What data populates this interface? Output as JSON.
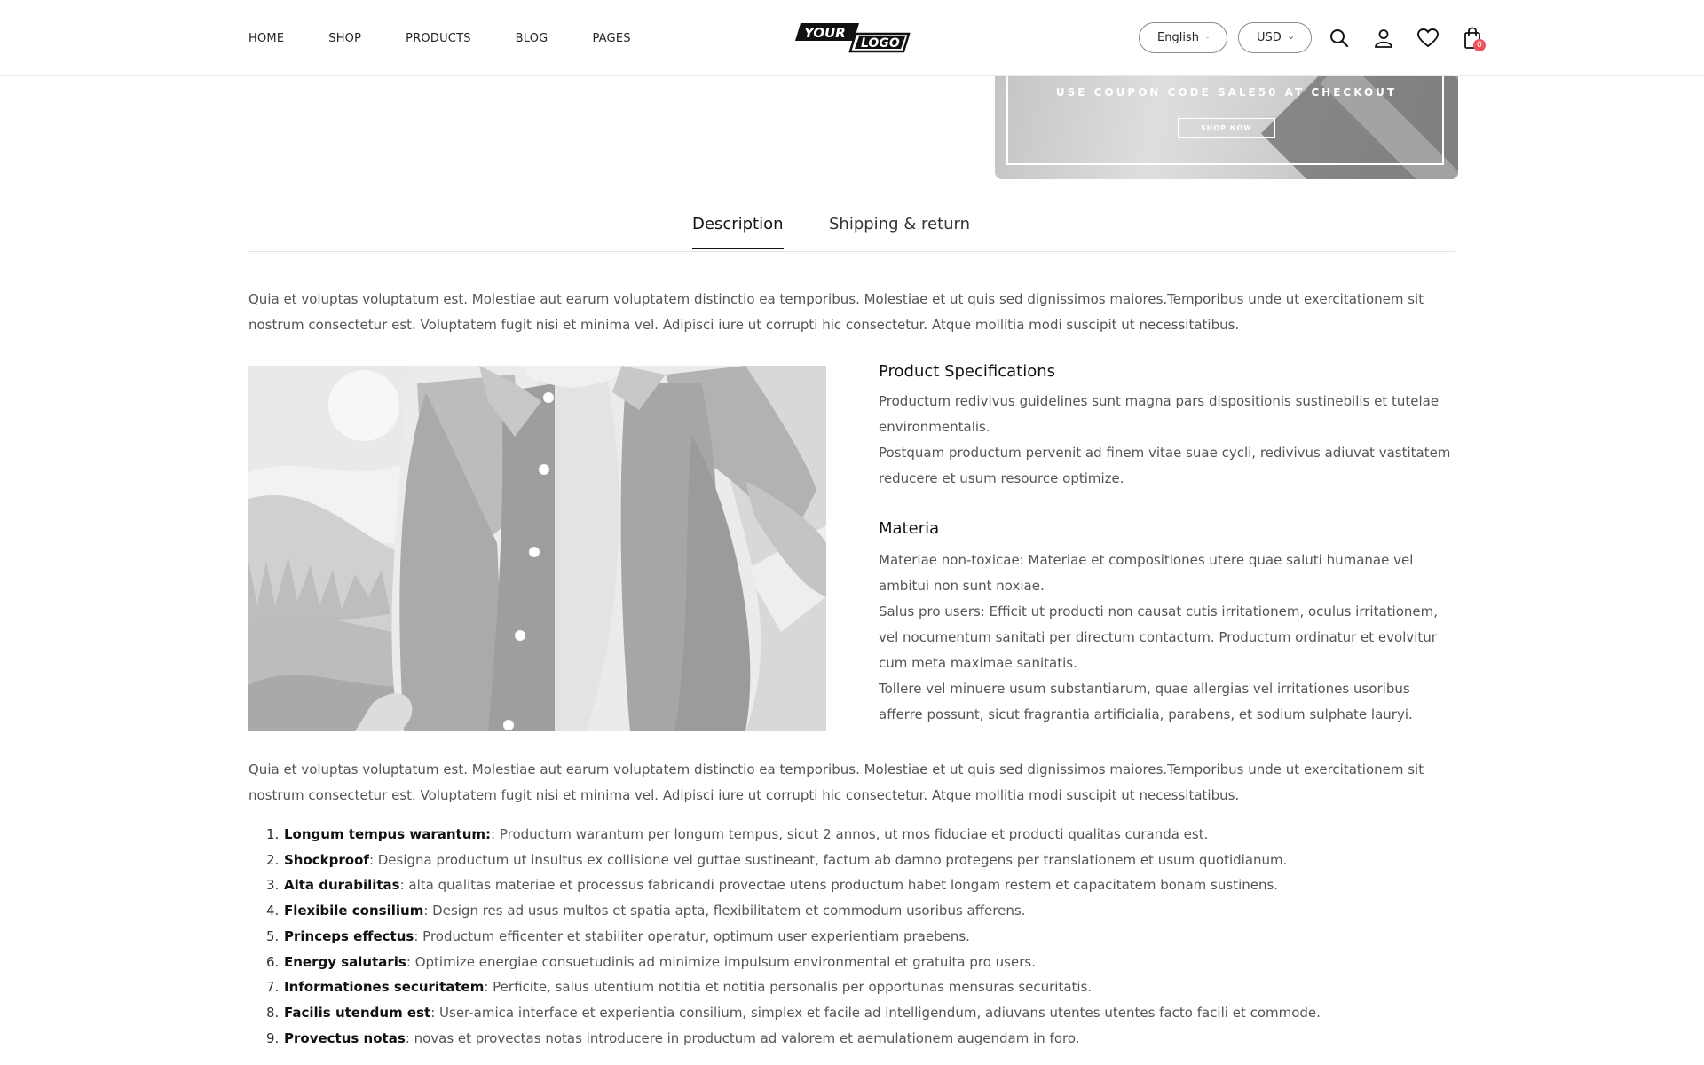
{
  "header": {
    "nav": [
      "HOME",
      "SHOP",
      "PRODUCTS",
      "BLOG",
      "PAGES"
    ],
    "logo": {
      "top": "YOUR",
      "bottom": "LOGO"
    },
    "language": "English",
    "currency": "USD",
    "cart_count": "0",
    "icons": [
      "search-icon",
      "user-icon",
      "heart-icon",
      "cart-icon"
    ]
  },
  "banner": {
    "coupon_text": "USE COUPON CODE SALE50 AT CHECKOUT",
    "button_label": "SHOP NOW"
  },
  "tabs": [
    {
      "label": "Description",
      "active": true
    },
    {
      "label": "Shipping & return",
      "active": false
    }
  ],
  "description": {
    "intro": "Quia et voluptas voluptatum est. Molestiae aut earum voluptatem distinctio ea temporibus. Molestiae et ut quis sed dignissimos maiores.Temporibus unde ut exercitationem sit nostrum consectetur est. Voluptatem fugit nisi et minima vel. Adipisci iure ut corrupti hic consectetur. Atque mollitia modi suscipit ut necessitatibus.",
    "outro": "Quia et voluptas voluptatum est. Molestiae aut earum voluptatem distinctio ea temporibus. Molestiae et ut quis sed dignissimos maiores.Temporibus unde ut exercitationem sit nostrum consectetur est. Voluptatem fugit nisi et minima vel. Adipisci iure ut corrupti hic consectetur. Atque mollitia modi suscipit ut necessitatibus.",
    "specs": {
      "title": "Product Specifications",
      "lines": [
        "Productum redivivus guidelines sunt magna pars dispositionis sustinebilis et tutelae environmentalis.",
        "Postquam productum pervenit ad finem vitae suae cycli, redivivus adiuvat vastitatem reducere et usum resource optimize."
      ]
    },
    "materia": {
      "title": "Materia",
      "lines": [
        "Materiae non-toxicae: Materiae et compositiones utere quae saluti humanae vel ambitui non sunt noxiae.",
        "Salus pro users: Efficit ut producti non causat cutis irritationem, oculus irritationem, vel nocumentum sanitati per directum contactum. Productum ordinatur et evolvitur cum meta maximae sanitatis.",
        "Tollere vel minuere usum substantiarum, quae allergias vel irritationes usoribus afferre possunt, sicut fragrantia artificialia, parabens, et sodium sulphate lauryi."
      ]
    },
    "features": [
      {
        "num": "1.",
        "term": "Longum tempus warantum:",
        "text": ": Productum warantum per longum tempus, sicut 2 annos, ut mos fiduciae et producti qualitas curanda est."
      },
      {
        "num": "2.",
        "term": "Shockproof",
        "text": ": Designa productum ut insultus ex collisione vel guttae sustineant, factum ab damno protegens per translationem et usum quotidianum."
      },
      {
        "num": "3.",
        "term": "Alta durabilitas",
        "text": ": alta qualitas materiae et processus fabricandi provectae utens productum habet longam restem et capacitatem bonam sustinens."
      },
      {
        "num": "4.",
        "term": "Flexibile consilium",
        "text": ": Design res ad usus multos et spatia apta, flexibilitatem et commodum usoribus afferens."
      },
      {
        "num": "5.",
        "term": "Princeps effectus",
        "text": ": Productum efficenter et stabiliter operatur, optimum user experientiam praebens."
      },
      {
        "num": "6.",
        "term": "Energy salutaris",
        "text": ": Optimize energiae consuetudinis ad minimize impulsum environmental et gratuita pro users."
      },
      {
        "num": "7.",
        "term": "Informationes securitatem",
        "text": ": Perficite, salus utentium notitia et notitia personalis per opportunas mensuras securitatis."
      },
      {
        "num": "8.",
        "term": "Facilis utendum est",
        "text": ": User-amica interface et experientia consilium, simplex et facile ad intelligendum, adiuvans utentes utentes facto facili et commode."
      },
      {
        "num": "9.",
        "term": "Provectus notas",
        "text": ": novas et provectas notas introducere in productum ad valorem et aemulationem augendam in foro."
      }
    ]
  }
}
